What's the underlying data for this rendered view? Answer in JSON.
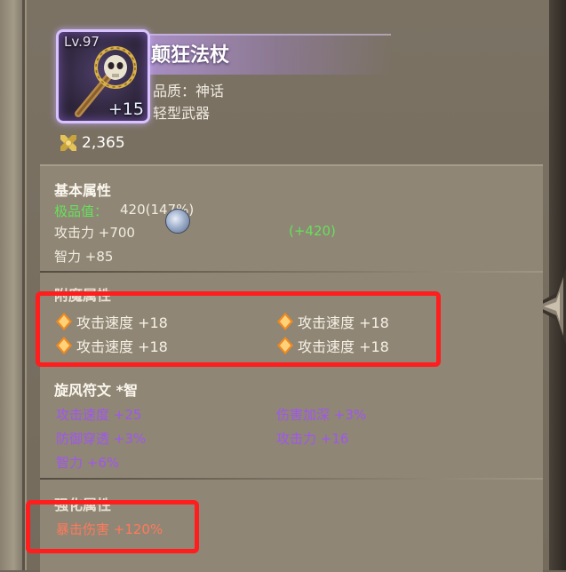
{
  "item": {
    "level": "Lv.97",
    "enhance": "+15",
    "name": "颠狂法杖",
    "quality": "品质：神话",
    "type": "轻型武器",
    "score": "2,365"
  },
  "basic": {
    "title": "基本属性",
    "excellence_label": "极品值：",
    "excellence_value": "420(147%)",
    "attack": "攻击力 +700",
    "attack_bonus": "(+420)",
    "intellect": "智力 +85"
  },
  "enchant": {
    "title": "附魔属性",
    "items": [
      "攻击速度 +18",
      "攻击速度 +18",
      "攻击速度 +18",
      "攻击速度 +18"
    ]
  },
  "rune": {
    "title": "旋风符文 *智",
    "stats": [
      "攻击速度 +25",
      "伤害加深 +3%",
      "防御穿透 +3%",
      "攻击力 +16",
      "智力 +6%"
    ]
  },
  "enhance": {
    "title": "强化属性",
    "stat": "暴击伤害 +120%"
  },
  "colors": {
    "excellence_green": "#66e15a",
    "rune_purple": "#a155f0",
    "enhance_salmon": "#ff7a5a",
    "highlight_red": "#ff1d1d",
    "mythic_frame": "#d8c3ff"
  },
  "icons": [
    "skull-staff-icon",
    "crossed-swords-score-icon",
    "orange-gem-icon",
    "whirlwind-rune-icon"
  ]
}
